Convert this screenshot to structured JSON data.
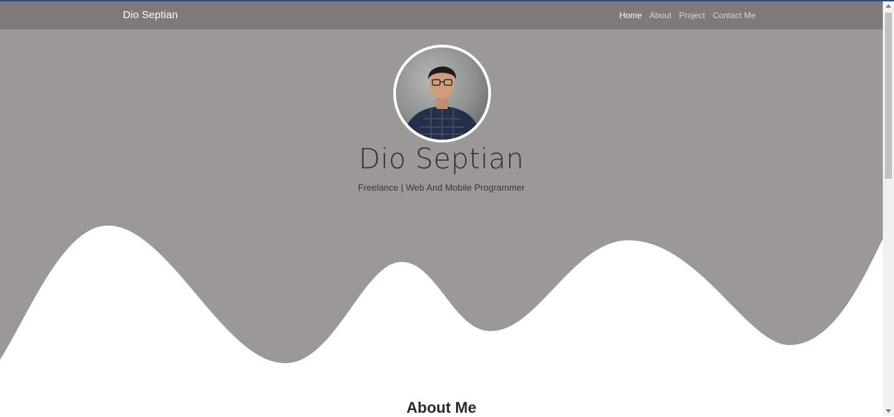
{
  "site": {
    "brand": "Dio Septian"
  },
  "nav": {
    "items": [
      {
        "label": "Home",
        "active": true
      },
      {
        "label": "About",
        "active": false
      },
      {
        "label": "Project",
        "active": false
      },
      {
        "label": "Contact Me",
        "active": false
      }
    ]
  },
  "hero": {
    "name": "Dio Septian",
    "tagline": "Freelance | Web And Mobile Programmer",
    "avatar_alt": "Profile photo"
  },
  "about": {
    "title": "About Me"
  },
  "colors": {
    "navbar": "#7f7979",
    "hero_bg": "#9c9898",
    "wave": "#ffffff",
    "accent_top": "#2e4a7a"
  }
}
